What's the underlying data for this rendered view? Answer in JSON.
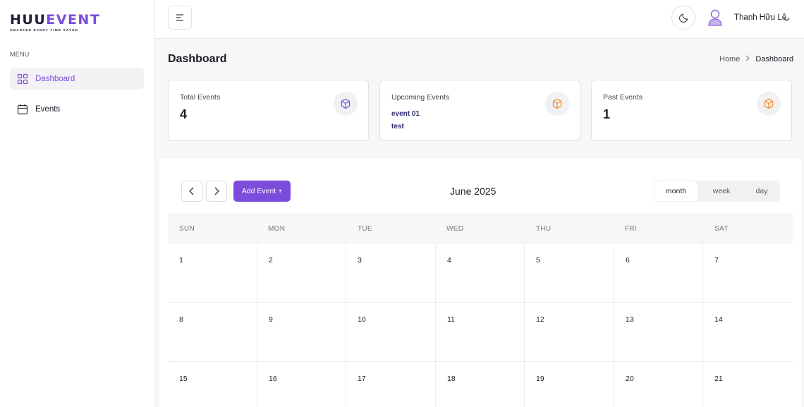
{
  "brand": {
    "logo_dark": "HUU",
    "logo_accent": "EVENT",
    "tagline": "SMARTER EVENT TIME SAVED"
  },
  "sidebar": {
    "menu_label": "MENU",
    "items": [
      {
        "label": "Dashboard",
        "icon": "grid-icon",
        "active": true
      },
      {
        "label": "Events",
        "icon": "calendar-icon",
        "active": false
      }
    ]
  },
  "header": {
    "user_name": "Thanh Hữu Lê"
  },
  "page": {
    "title": "Dashboard",
    "breadcrumb": [
      "Home",
      "Dashboard"
    ]
  },
  "stats": [
    {
      "title": "Total Events",
      "value": "4",
      "icon_color": "#7c4ddb"
    },
    {
      "title": "Upcoming Events",
      "items": [
        "event 01",
        "test"
      ],
      "icon_color": "#f08a24"
    },
    {
      "title": "Past Events",
      "value": "1",
      "icon_color": "#f08a24"
    }
  ],
  "calendar": {
    "title": "June 2025",
    "add_label": "Add Event +",
    "views": [
      "month",
      "week",
      "day"
    ],
    "active_view": "month",
    "weekdays": [
      "SUN",
      "MON",
      "TUE",
      "WED",
      "THU",
      "FRI",
      "SAT"
    ],
    "weeks": [
      [
        "1",
        "2",
        "3",
        "4",
        "5",
        "6",
        "7"
      ],
      [
        "8",
        "9",
        "10",
        "11",
        "12",
        "13",
        "14"
      ],
      [
        "15",
        "16",
        "17",
        "18",
        "19",
        "20",
        "21"
      ]
    ]
  },
  "colors": {
    "accent": "#7c4ddb",
    "orange": "#f08a24",
    "text": "#1c1c28"
  }
}
